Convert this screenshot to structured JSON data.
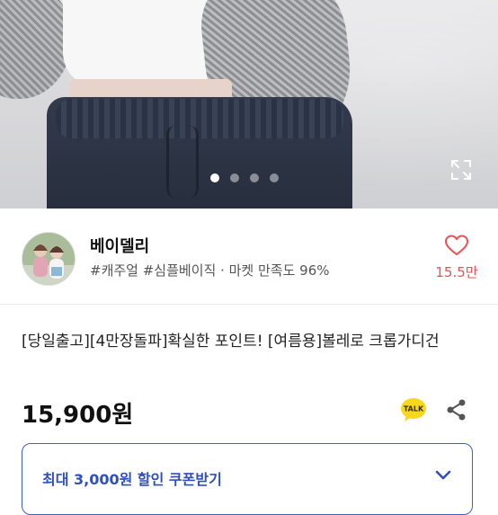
{
  "product_image": {
    "carousel_total": 4,
    "carousel_active_index": 1,
    "expand_icon": "expand-icon"
  },
  "seller": {
    "name": "베이델리",
    "tags": "#캐주얼 #심플베이직 · 마켓 만족도 96%",
    "like_count": "15.5만",
    "like_icon": "heart-outline-icon",
    "accent_color": "#ef5055"
  },
  "product": {
    "title": "[당일출고][4만장돌파]확실한 포인트! [여름용]볼레로 크롭가디건",
    "price": "15,900원",
    "talk_badge": "TALK"
  },
  "coupon": {
    "label": "최대 3,000원 할인 쿠폰받기",
    "accent_color": "#2e4fbf"
  }
}
